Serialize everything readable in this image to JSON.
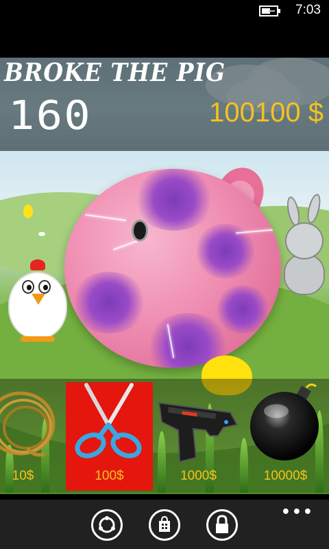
{
  "status_bar": {
    "time": "7:03",
    "battery_icon": "battery-charging-icon"
  },
  "header": {
    "title": "BROKE THE PIG",
    "score": "160",
    "money": "100100 $",
    "money_color": "#f6c21e"
  },
  "scene": {
    "target": "pig",
    "background_characters": [
      "chicken",
      "bunny",
      "duck",
      "small-chick"
    ]
  },
  "shop": {
    "items": [
      {
        "name": "rope",
        "icon": "rope-icon",
        "price": "10$",
        "selected": false
      },
      {
        "name": "scissors",
        "icon": "scissors-icon",
        "price": "100$",
        "selected": true
      },
      {
        "name": "pistol",
        "icon": "pistol-icon",
        "price": "1000$",
        "selected": false
      },
      {
        "name": "bomb",
        "icon": "bomb-icon",
        "price": "10000$",
        "selected": false
      }
    ],
    "selected_color": "#e4160e",
    "price_color": "#f6c21e"
  },
  "app_bar": {
    "buttons": [
      {
        "icon": "sync-icon"
      },
      {
        "icon": "store-icon"
      },
      {
        "icon": "lock-icon"
      }
    ],
    "more": "•••"
  }
}
